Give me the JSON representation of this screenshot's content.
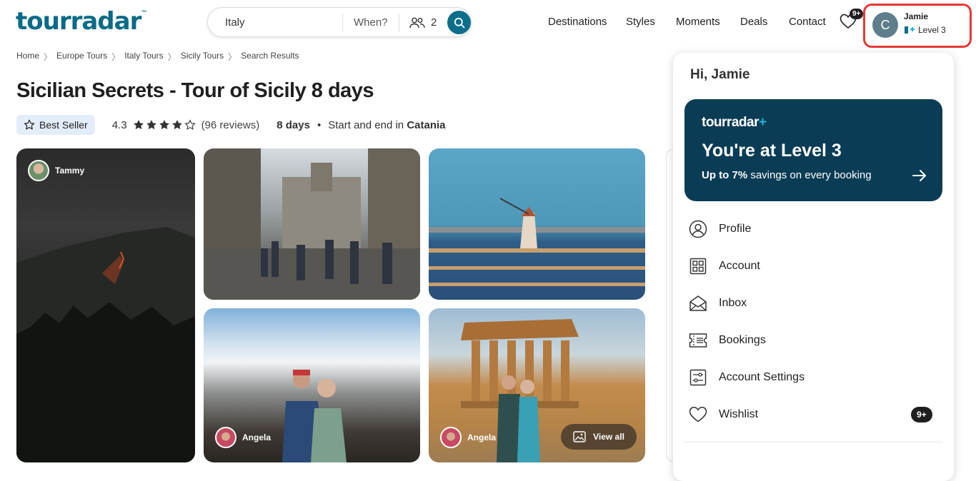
{
  "header": {
    "logo_text": "tourradar",
    "logo_tm": "™",
    "search": {
      "destination": "Italy",
      "when_label": "When?",
      "travelers": "2"
    },
    "nav": [
      "Destinations",
      "Styles",
      "Moments",
      "Deals",
      "Contact"
    ],
    "wishlist_badge": "9+",
    "user": {
      "initial": "C",
      "name": "Jamie",
      "level": "Level 3"
    }
  },
  "breadcrumb": [
    "Home",
    "Europe Tours",
    "Italy Tours",
    "Sicily Tours",
    "Search Results"
  ],
  "tour": {
    "title": "Sicilian Secrets - Tour of Sicily 8 days",
    "badge": "Best Seller",
    "rating": "4.3",
    "rating_stars": 4.3,
    "reviews": "(96 reviews)",
    "duration": "8 days",
    "start_end_prefix": "Start and end in",
    "start_end_city": "Catania"
  },
  "gallery": {
    "reviewer_1": "Tammy",
    "reviewer_2": "Angela",
    "reviewer_3": "Angela",
    "view_all": "View all"
  },
  "dropdown": {
    "greeting": "Hi, Jamie",
    "promo": {
      "logo_text": "tourradar",
      "logo_plus": "+",
      "level_title": "You're at Level 3",
      "savings_bold": "Up to 7%",
      "savings_rest": "savings on every booking"
    },
    "items": [
      {
        "label": "Profile",
        "icon": "profile-icon"
      },
      {
        "label": "Account",
        "icon": "account-icon"
      },
      {
        "label": "Inbox",
        "icon": "inbox-icon"
      },
      {
        "label": "Bookings",
        "icon": "bookings-icon"
      },
      {
        "label": "Account Settings",
        "icon": "settings-icon"
      },
      {
        "label": "Wishlist",
        "icon": "heart-icon"
      }
    ],
    "wishlist_badge": "9+"
  },
  "colors": {
    "brand": "#0a6b87",
    "promo_bg": "#0b3c55",
    "highlight": "#e53935",
    "badge_bg": "#e3edf9"
  }
}
